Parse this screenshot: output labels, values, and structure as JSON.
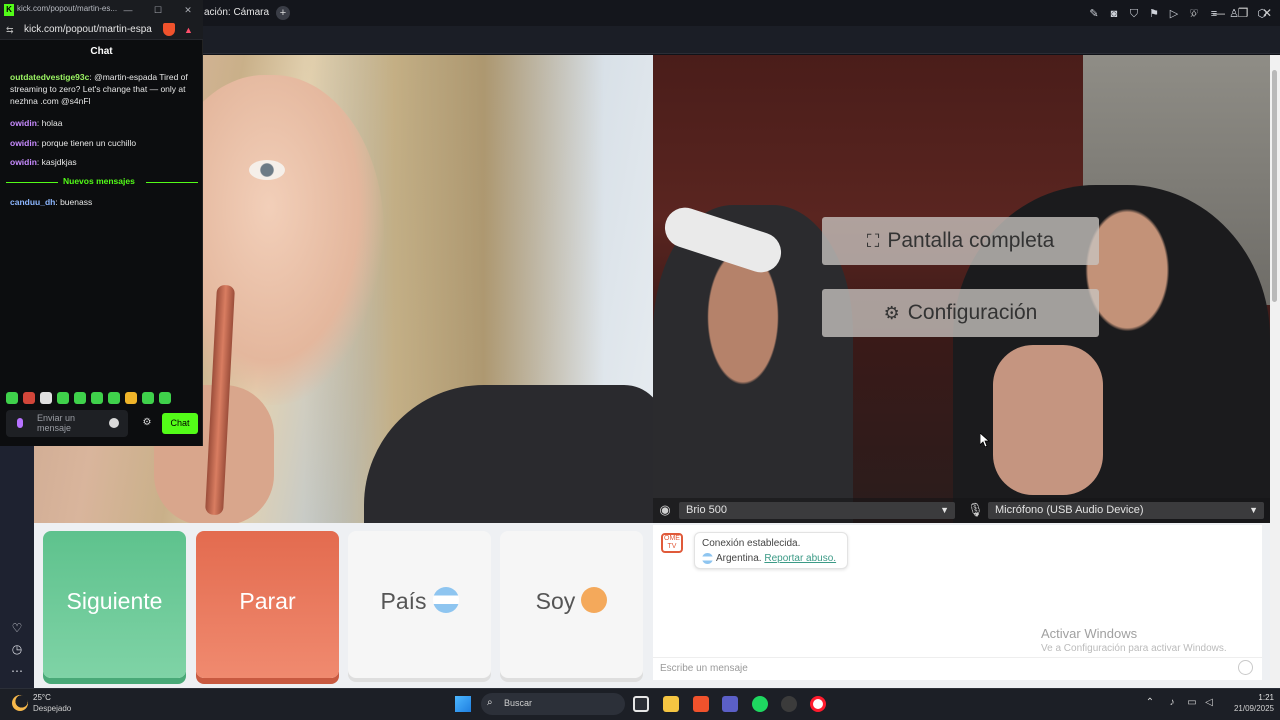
{
  "browser": {
    "tab_title": "ación: Cámara",
    "new_tab": "+",
    "controls": {
      "search": "⌕",
      "minimize": "—",
      "restore": "❐",
      "close": "✕"
    },
    "toolbar_icons": [
      "edit-icon",
      "camera-icon",
      "shield-icon",
      "vpn-icon",
      "play-icon",
      "heart-icon",
      "menu-icon",
      "profile-icon",
      "extension-icon"
    ]
  },
  "video": {
    "overlay": {
      "fullscreen_label": "Pantalla completa",
      "settings_label": "Configuración"
    },
    "devices": {
      "camera": "Brio 500",
      "microphone": "Micrófono (USB Audio Device)"
    }
  },
  "actions": {
    "next": "Siguiente",
    "stop": "Parar",
    "country": "País",
    "soy": "Soy"
  },
  "omegle_chat": {
    "logo_text": "OME TV",
    "status": "Conexión establecida.",
    "country": "Argentina.",
    "report_link": "Reportar abuso.",
    "input_placeholder": "Escribe un mensaje"
  },
  "windows_watermark": {
    "title": "Activar Windows",
    "subtitle": "Ve a Configuración para activar Windows."
  },
  "kick": {
    "window_title": "kick.com/popout/martin-es...",
    "url": "kick.com/popout/martin-espa...",
    "chat_header": "Chat",
    "messages": [
      {
        "user": "outdatedvestige93c",
        "text": ": @martin-espada Tired of streaming to zero? Let's change that — only at nezhna .com @s4nFl",
        "color": "green"
      },
      {
        "user": "owidin",
        "text": ": holaa",
        "color": "purple"
      },
      {
        "user": "owidin",
        "text": ": porque tienen un cuchillo",
        "color": "purple"
      },
      {
        "user": "owidin",
        "text": ": kasjdkjas",
        "color": "purple"
      }
    ],
    "new_messages_label": "Nuevos mensajes",
    "after_messages": [
      {
        "user": "canduu_dh",
        "text": ": buenass",
        "color": "blue"
      }
    ],
    "input_placeholder": "Enviar un mensaje",
    "send_button": "Chat"
  },
  "taskbar": {
    "weather_temp": "25°C",
    "weather_desc": "Despejado",
    "search_placeholder": "Buscar",
    "time": "1:21",
    "date": "21/09/2025",
    "apps": [
      "file-explorer-icon",
      "folder-icon",
      "brave-icon",
      "teams-icon",
      "spotify-icon",
      "obs-icon",
      "opera-icon"
    ],
    "colors": {
      "brave": "#f0522c",
      "teams": "#5b5fc7",
      "spotify": "#1ed760",
      "obs": "#3b3b3b",
      "opera": "#ff1b2d",
      "explorer": "#f5c542"
    }
  }
}
